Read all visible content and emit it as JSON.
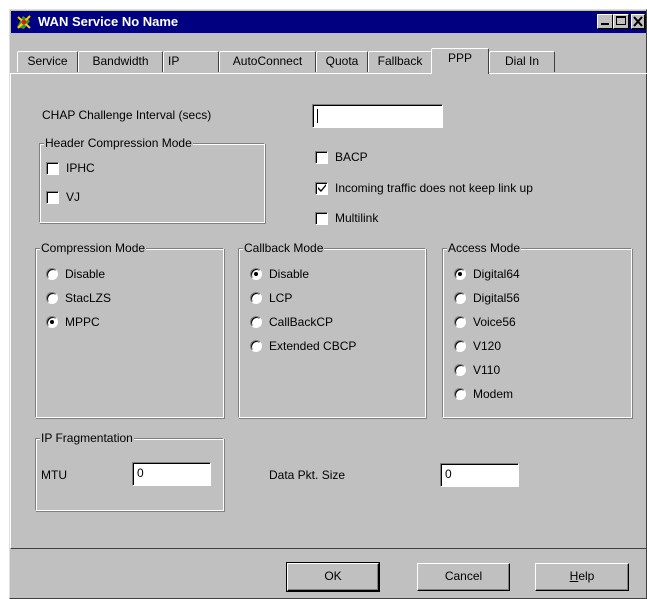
{
  "window": {
    "title": "WAN Service No Name",
    "icon": "network-icon",
    "controls": [
      "minimize-icon",
      "maximize-icon",
      "close-icon"
    ]
  },
  "tabs": [
    "Service",
    "Bandwidth",
    "IP",
    "AutoConnect",
    "Quota",
    "Fallback",
    "PPP",
    "Dial In"
  ],
  "active_tab": "PPP",
  "chap": {
    "label": "CHAP Challenge Interval (secs)",
    "value": ""
  },
  "header_compression": {
    "legend": "Header Compression Mode",
    "options": [
      {
        "label": "IPHC",
        "checked": false
      },
      {
        "label": "VJ",
        "checked": false
      }
    ]
  },
  "flags": [
    {
      "label": "BACP",
      "checked": false
    },
    {
      "label": "Incoming traffic does not keep link up",
      "checked": true
    },
    {
      "label": "Multilink",
      "checked": false
    }
  ],
  "compression_mode": {
    "legend": "Compression Mode",
    "options": [
      "Disable",
      "StacLZS",
      "MPPC"
    ],
    "selected": "MPPC"
  },
  "callback_mode": {
    "legend": "Callback Mode",
    "options": [
      "Disable",
      "LCP",
      "CallBackCP",
      "Extended CBCP"
    ],
    "selected": "Disable"
  },
  "access_mode": {
    "legend": "Access Mode",
    "options": [
      "Digital64",
      "Digital56",
      "Voice56",
      "V120",
      "V110",
      "Modem"
    ],
    "selected": "Digital64"
  },
  "ip_fragmentation": {
    "legend": "IP Fragmentation",
    "mtu_label": "MTU",
    "mtu_value": "0"
  },
  "data_pkt": {
    "label": "Data Pkt. Size",
    "value": "0"
  },
  "buttons": {
    "ok": "OK",
    "cancel": "Cancel",
    "help_first": "H",
    "help_rest": "elp"
  }
}
